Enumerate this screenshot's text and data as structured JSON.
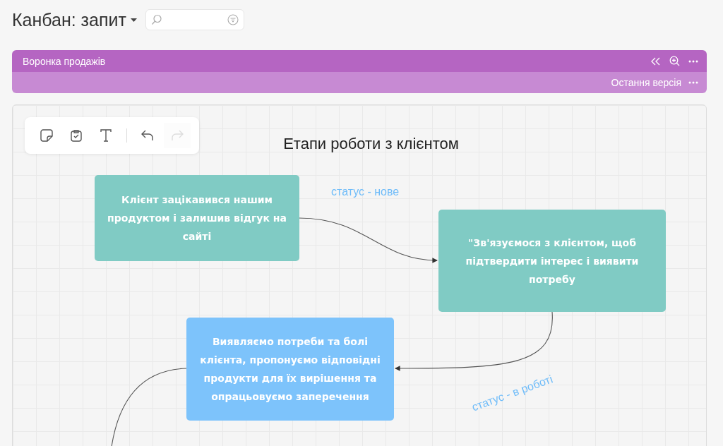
{
  "header": {
    "title": "Канбан: запит"
  },
  "board": {
    "name": "Воронка продажів",
    "version": "Остання версія"
  },
  "toolbar": [
    {
      "kind": "sticky",
      "disabled": false
    },
    {
      "kind": "task",
      "disabled": false
    },
    {
      "kind": "text",
      "disabled": false
    },
    {
      "kind": "undo",
      "disabled": false
    },
    {
      "kind": "redo",
      "disabled": true
    }
  ],
  "canvas": {
    "title": "Етапи роботи з клієнтом",
    "nodes": [
      {
        "text": "Клієнт зацікавився нашим продуктом і залишив відгук на сайті",
        "color": "#80cbc4"
      },
      {
        "text": "\"Зв'язуємося з клієнтом, щоб підтвердити інтерес і виявити потребу",
        "color": "#80cbc4"
      },
      {
        "text": "Виявляємо потреби та болі клієнта, пропонуємо відповідні продукти для їх вирішення та опрацьовуємо заперечення",
        "color": "#7dc3fb"
      }
    ],
    "labels": [
      "статус - нове",
      "статус - в роботі"
    ]
  }
}
